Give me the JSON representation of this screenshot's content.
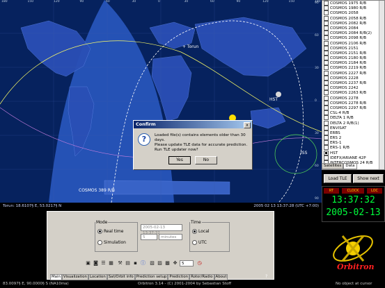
{
  "map": {
    "top_ticks": [
      "180",
      "150",
      "120",
      "90",
      "60",
      "30",
      "0",
      "30",
      "60",
      "90",
      "120",
      "150",
      "180"
    ],
    "right_ticks": [
      "90",
      "60",
      "30",
      "0",
      "30",
      "60",
      "90"
    ],
    "labels": {
      "torun": "+ Torun",
      "hst": "HST",
      "iss": "ISS",
      "cosmos": "COSMOS 389 R/B"
    }
  },
  "coords": {
    "left": "Torun: 18.6107§ E, 53.0217§ N",
    "right": "2005 02 13 13:37:28 (UTC +7:00)"
  },
  "satellites": [
    "COSMOS 1975 R/B",
    "COSMOS 1980 R/B",
    "COSMOS 2058",
    "COSMOS 2058 R/B",
    "COSMOS 2082 R/B",
    "COSMOS 2084",
    "COSMOS 2084 R/B(2)",
    "COSMOS 2098 R/B",
    "COSMOS 2106 R/B",
    "COSMOS 2151",
    "COSMOS 2151 R/B",
    "COSMOS 2180 R/B",
    "COSMOS 2184 R/B",
    "COSMOS 2219 R/B",
    "COSMOS 2227 R/B",
    "COSMOS 2228",
    "COSMOS 2237 R/B",
    "COSMOS 2242",
    "COSMOS 2263 R/B",
    "COSMOS 2278",
    "COSMOS 2278 R/B",
    "COSMOS 2297 R/B",
    "CSL-4 R/B",
    "DELTA 1 R/B",
    "DELTA 2 R/B(1)",
    "ENVISAT",
    "ERBS",
    "ERS 2",
    "ERS-1",
    "ERS-1 R/B",
    "HST",
    "IDEFX/ARIANE 42P",
    "INTERCOSMOS 24 R/B"
  ],
  "checked_satellites": [
    "HST"
  ],
  "sat_tabs": [
    "Satellites",
    "Data"
  ],
  "buttons": {
    "load_tle": "Load TLE",
    "show_next": "Show next"
  },
  "clock": {
    "headers": [
      "RT",
      "CLOCK",
      "LOC"
    ],
    "time": "13:37:32",
    "date": "2005-02-13"
  },
  "logo_text": "Orbitron",
  "control": {
    "mode_legend": "Mode",
    "real_time": "Real time",
    "simulation": "Simulation",
    "datetime_field": "2005-02-13 13:37:32",
    "step_value": "5",
    "step_unit": "minutes",
    "time_legend": "Time",
    "local": "Local",
    "utc": "UTC",
    "toolbar_select": "5"
  },
  "bottom_tabs": [
    "Main",
    "Visualization",
    "Location",
    "Sat/Orbit info",
    "Prediction setup",
    "Prediction",
    "Rotor/Radio",
    "About"
  ],
  "help": "?",
  "status": {
    "left": "83.0097§ E, 90.0000§ S (NA10ma)",
    "center": "Orbitron 3.14 - (C) 2001-2004 by Sebastian Stoff",
    "right": "No object at cursor"
  },
  "dialog": {
    "title": "Confirm",
    "close": "x",
    "icon": "?",
    "lines": [
      "Loaded file(s) contains elements older than 30 days.",
      "Please update TLE data for accurate prediction.",
      "Run TLE updater now?"
    ],
    "yes": "Yes",
    "no": "No"
  }
}
